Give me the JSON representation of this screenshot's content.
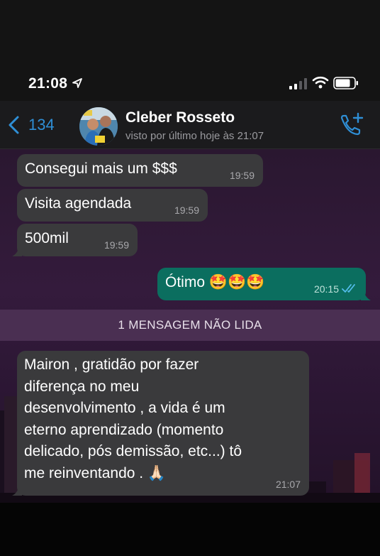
{
  "status_bar": {
    "time": "21:08"
  },
  "header": {
    "back_count": "134",
    "contact_name": "Cleber Rosseto",
    "last_seen": "visto por último hoje às 21:07"
  },
  "messages": [
    {
      "direction": "in",
      "text": "Consegui mais um $$$",
      "time": "19:59"
    },
    {
      "direction": "in",
      "text": "Visita agendada",
      "time": "19:59"
    },
    {
      "direction": "in",
      "text": "500mil",
      "time": "19:59"
    },
    {
      "direction": "out",
      "text": "Ótimo 🤩🤩🤩",
      "time": "20:15",
      "status": "read"
    },
    {
      "direction": "in",
      "text": "Mairon , gratidão por fazer\ndiferença no meu\ndesenvolvimento , a vida é um\neterno aprendizado (momento\ndelicado, pós demissão, etc...) tô\nme reinventando . 🙏🏻",
      "time": "21:07"
    }
  ],
  "unread_banner": "1 MENSAGEM NÃO LIDA",
  "colors": {
    "accent": "#2f8fd6",
    "incoming_bubble": "#3a3a3c",
    "outgoing_bubble": "#0b6e5f",
    "read_ticks": "#53bdeb",
    "unread_banner": "#4a2f52"
  }
}
